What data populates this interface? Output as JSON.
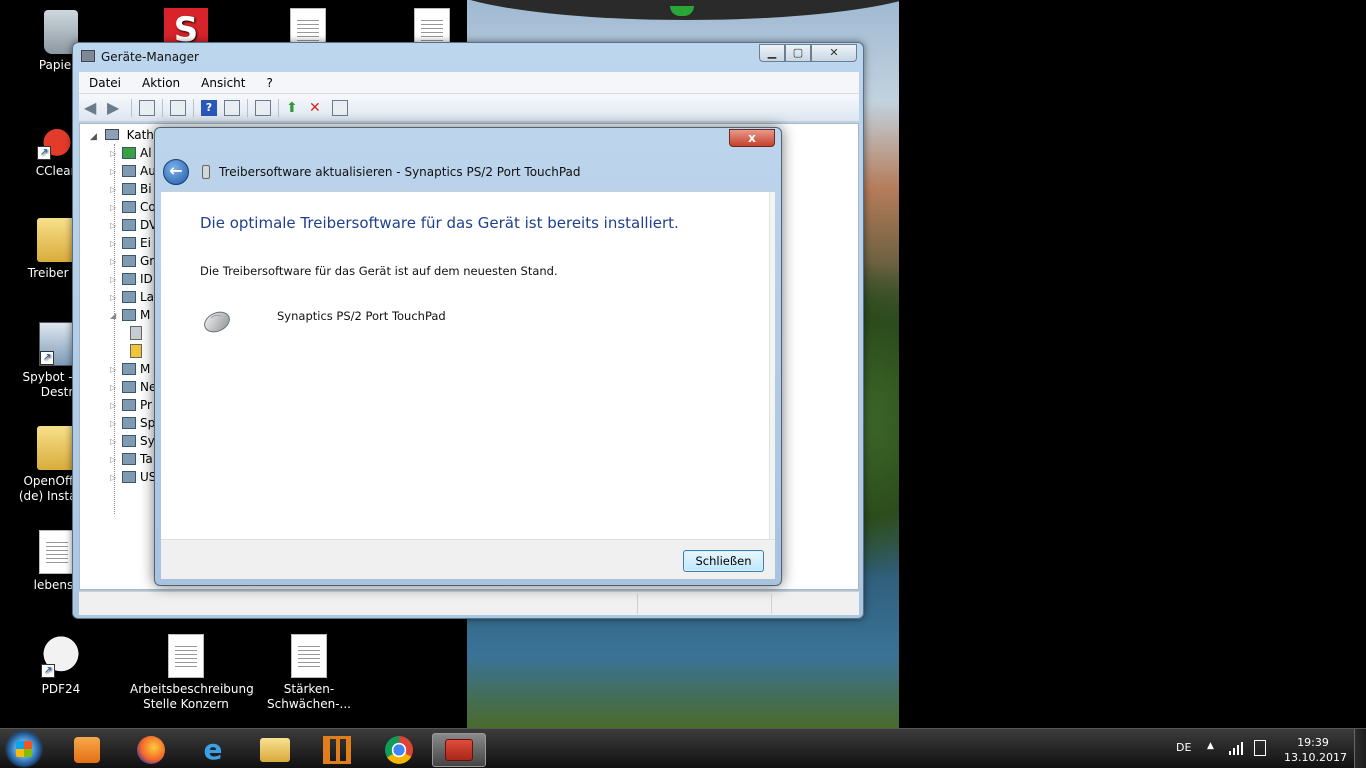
{
  "desktop": {
    "icons": [
      {
        "label": "Papierk",
        "kind": "trash"
      },
      {
        "label": "CClean",
        "kind": "ccleaner"
      },
      {
        "label": "Treiber Fü",
        "kind": "folder"
      },
      {
        "label": "Spybot - Se\nDestr",
        "kind": "spybot"
      },
      {
        "label": "OpenOffice\n(de) Installat",
        "kind": "folder"
      },
      {
        "label": "lebensv",
        "kind": "doc"
      },
      {
        "label": "PDF24",
        "kind": "pdf24"
      },
      {
        "label": "Arbeitsbeschreibung\nStelle Konzern",
        "kind": "doc"
      },
      {
        "label": "Stärken-Schwächen-...",
        "kind": "doc"
      }
    ],
    "top_icons": [
      {
        "kind": "sred",
        "glyph": "S"
      },
      {
        "kind": "doc"
      },
      {
        "kind": "doc"
      }
    ]
  },
  "device_manager": {
    "title": "Geräte-Manager",
    "menu": [
      "Datei",
      "Aktion",
      "Ansicht",
      "?"
    ],
    "tree": {
      "root": "Kathy",
      "items": [
        "Al",
        "Au",
        "Bi",
        "Co",
        "DV",
        "Ei",
        "Gr",
        "ID",
        "La",
        "M",
        "M",
        "Ne",
        "Pr",
        "Sp",
        "Sy",
        "Ta",
        "US"
      ]
    }
  },
  "dialog": {
    "title": "Treibersoftware aktualisieren - Synaptics PS/2 Port TouchPad",
    "heading": "Die optimale Treibersoftware für das Gerät ist bereits installiert.",
    "text": "Die Treibersoftware für das Gerät ist auf dem neuesten Stand.",
    "device_name": "Synaptics PS/2 Port TouchPad",
    "close_button": "Schließen",
    "close_glyph": "x"
  },
  "taskbar": {
    "language": "DE",
    "time": "19:39",
    "date": "13.10.2017",
    "accent": "#1d4f86"
  }
}
